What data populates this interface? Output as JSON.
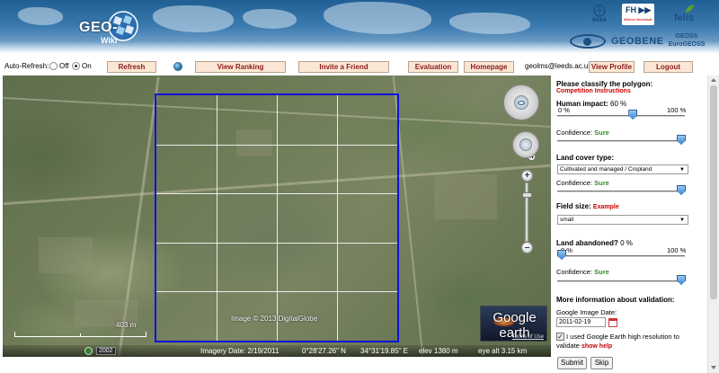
{
  "header": {
    "logo_text": "GEO-",
    "logo_sub": "Wiki",
    "partners": {
      "iiasa": "IIASA",
      "fh": "FH ▶▶",
      "fh_sub": "Wiener Neustadt",
      "felis": "felis",
      "geobene": "GEOBENE",
      "geoss_top": "GEOSS",
      "geoss_bottom": "EuroGEOSS"
    }
  },
  "toolbar": {
    "auto_refresh_label": "Auto-Refresh:",
    "off_label": "Off",
    "on_label": "On",
    "auto_refresh_selected": "On",
    "refresh": "Refresh",
    "view_ranking": "View Ranking",
    "invite_friend": "Invite a Friend",
    "evaluation": "Evaluation",
    "homepage": "Homepage",
    "email": "geolms@leeds.ac.uk",
    "view_profile": "View Profile",
    "logout": "Logout"
  },
  "map": {
    "copyright": "Image © 2013 DigitalGlobe",
    "scale_label": "403 m",
    "north_label": "N",
    "year_badge": "2002",
    "zoom_in": "+",
    "zoom_out": "–",
    "status": {
      "imagery_date": "Imagery Date: 2/19/2011",
      "latitude": "0°28'27.26\" N",
      "longitude": "34°31'19.85\" E",
      "elevation": "elev  1380 m",
      "eye_alt": "eye alt  3.15 km"
    },
    "google_earth": {
      "logo": "Google earth",
      "terms": "Terms of Use"
    },
    "grid": {
      "rows": 5,
      "cols": 4
    }
  },
  "panel": {
    "classify_title": "Please classify the polygon:",
    "competition_link": "Competition Instructions",
    "human_impact_label": "Human impact:",
    "human_impact_value": "60 %",
    "human_impact_fraction": 0.6,
    "human_min": "0 %",
    "human_max": "100 %",
    "confidence_label": "Confidence:",
    "confidence_value": "Sure",
    "land_cover_title": "Land cover type:",
    "land_cover_value": "Cultivated and managed / Cropland",
    "field_size_title": "Field size:",
    "field_size_link": "Example",
    "field_size_value": "small",
    "land_abandoned_label": "Land abandoned?",
    "land_abandoned_value": "0 %",
    "land_abandoned_fraction": 0.0,
    "abandoned_min": "0 %",
    "abandoned_max": "100 %",
    "more_info_title": "More information about validation:",
    "image_date_label": "Google Image Date:",
    "image_date_value": "2011-02-19",
    "ge_checkbox_text_1": "I used Google Earth high resolution to",
    "ge_checkbox_text_2": "validate",
    "show_help": "show help",
    "ge_checked": true,
    "submit": "Submit",
    "skip": "Skip"
  },
  "colors": {
    "button_bg": "#fbe7d5",
    "button_text": "#8b1a1a",
    "polygon": "#1212d8",
    "link_red": "#c80000",
    "confidence_green": "#2f8f20"
  }
}
